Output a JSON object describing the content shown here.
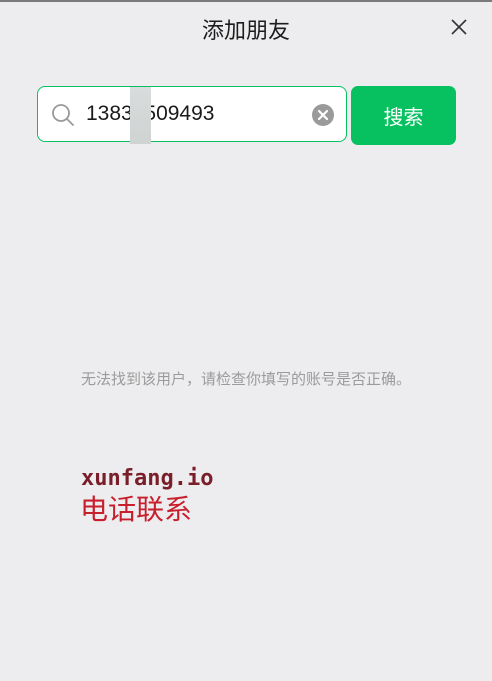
{
  "dialog": {
    "title": "添加朋友",
    "close_icon": "close-icon"
  },
  "search": {
    "value": "1383  509493",
    "search_icon": "search-icon",
    "clear_icon": "clear-circle-icon",
    "button_label": "搜索",
    "accent_color": "#07c160"
  },
  "result": {
    "message": "无法找到该用户，请检查你填写的账号是否正确。"
  },
  "watermark": {
    "line1": "xunfang.io",
    "line2": "电话联系"
  }
}
